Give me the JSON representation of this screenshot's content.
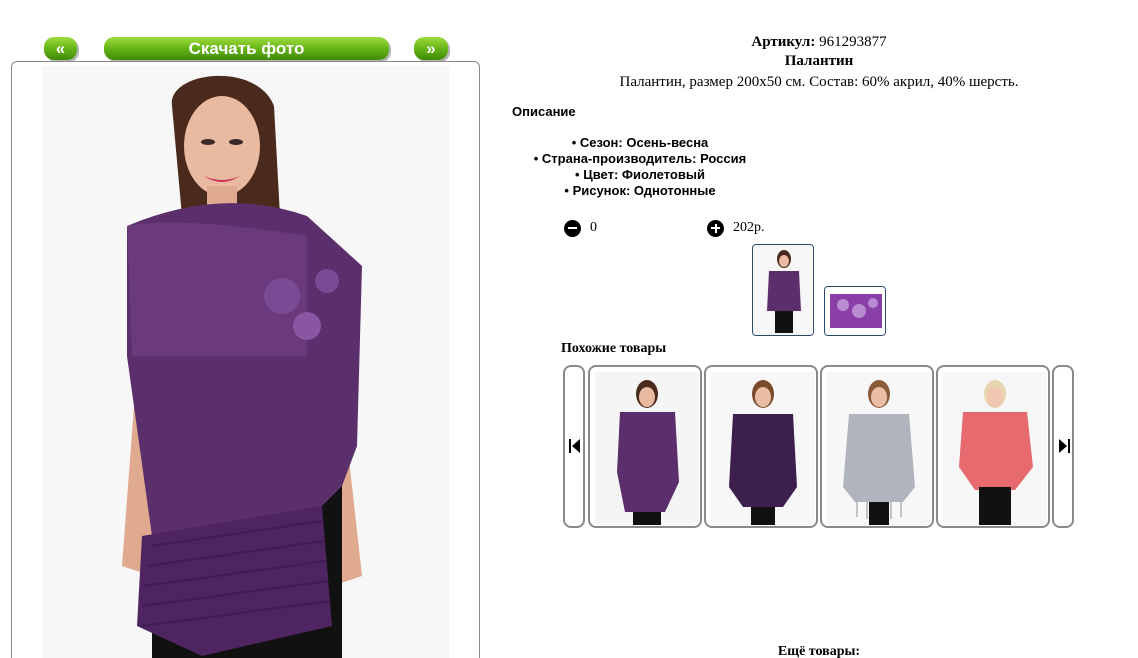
{
  "gallery": {
    "prev_label": "«",
    "download_label": "Скачать фото",
    "next_label": "»"
  },
  "product": {
    "article_label": "Артикул:",
    "article_value": "961293877",
    "name": "Палантин",
    "short_description": "Палантин, размер 200x50 см. Состав: 60% акрил, 40% шерсть."
  },
  "description": {
    "title": "Описание",
    "specs": [
      "Сезон: Осень-весна",
      "Страна-производитель: Россия",
      "Цвет: Фиолетовый",
      "Рисунок: Однотонные"
    ]
  },
  "cart": {
    "quantity": "0",
    "price": "202р."
  },
  "similar": {
    "title": "Похожие товары",
    "items": [
      {
        "icon": "purple-shawl-photo",
        "color": "#5b2f6b"
      },
      {
        "icon": "dark-purple-shawl-photo",
        "color": "#3d1f4e"
      },
      {
        "icon": "grey-lace-shawl-photo",
        "color": "#b0b4bc"
      },
      {
        "icon": "coral-shawl-photo",
        "color": "#e66a6e"
      }
    ]
  },
  "more": {
    "title": "Ещё товары:"
  },
  "colors": {
    "button_green": "#66b417",
    "shawl_purple": "#5b2f6b",
    "frame_border": "#8a8a8a",
    "thumb_border": "#2a4a6b"
  }
}
